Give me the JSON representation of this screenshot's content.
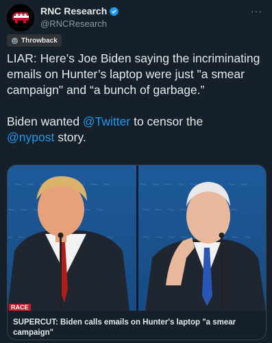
{
  "tweet": {
    "author_name": "RNC Research",
    "handle": "@RNCResearch",
    "more_label": "···",
    "throwback_label": "Throwback",
    "text_line1": "LIAR: Here’s Joe Biden saying the incriminating emails on Hunter’s laptop were just \"a smear campaign\" and “a bunch of garbage.”",
    "text_line2_a": "Biden wanted ",
    "text_mention1": "@Twitter",
    "text_line2_b": " to censor the",
    "text_mention2": "@nypost",
    "text_line2_c": " story."
  },
  "card": {
    "race_tag": "RACE",
    "caption": "SUPERCUT: Biden calls emails on Hunter's laptop \"a smear campaign\""
  },
  "colors": {
    "background": "#15202b",
    "accent": "#1d9bf0",
    "text": "#e7e9ea",
    "secondary": "#8b98a5",
    "verified": "#1d9bf0"
  },
  "icons": {
    "avatar": "republican-elephant-logo",
    "verified": "verified-badge-icon",
    "throwback": "throwback-emoji-icon",
    "more": "more-icon"
  }
}
